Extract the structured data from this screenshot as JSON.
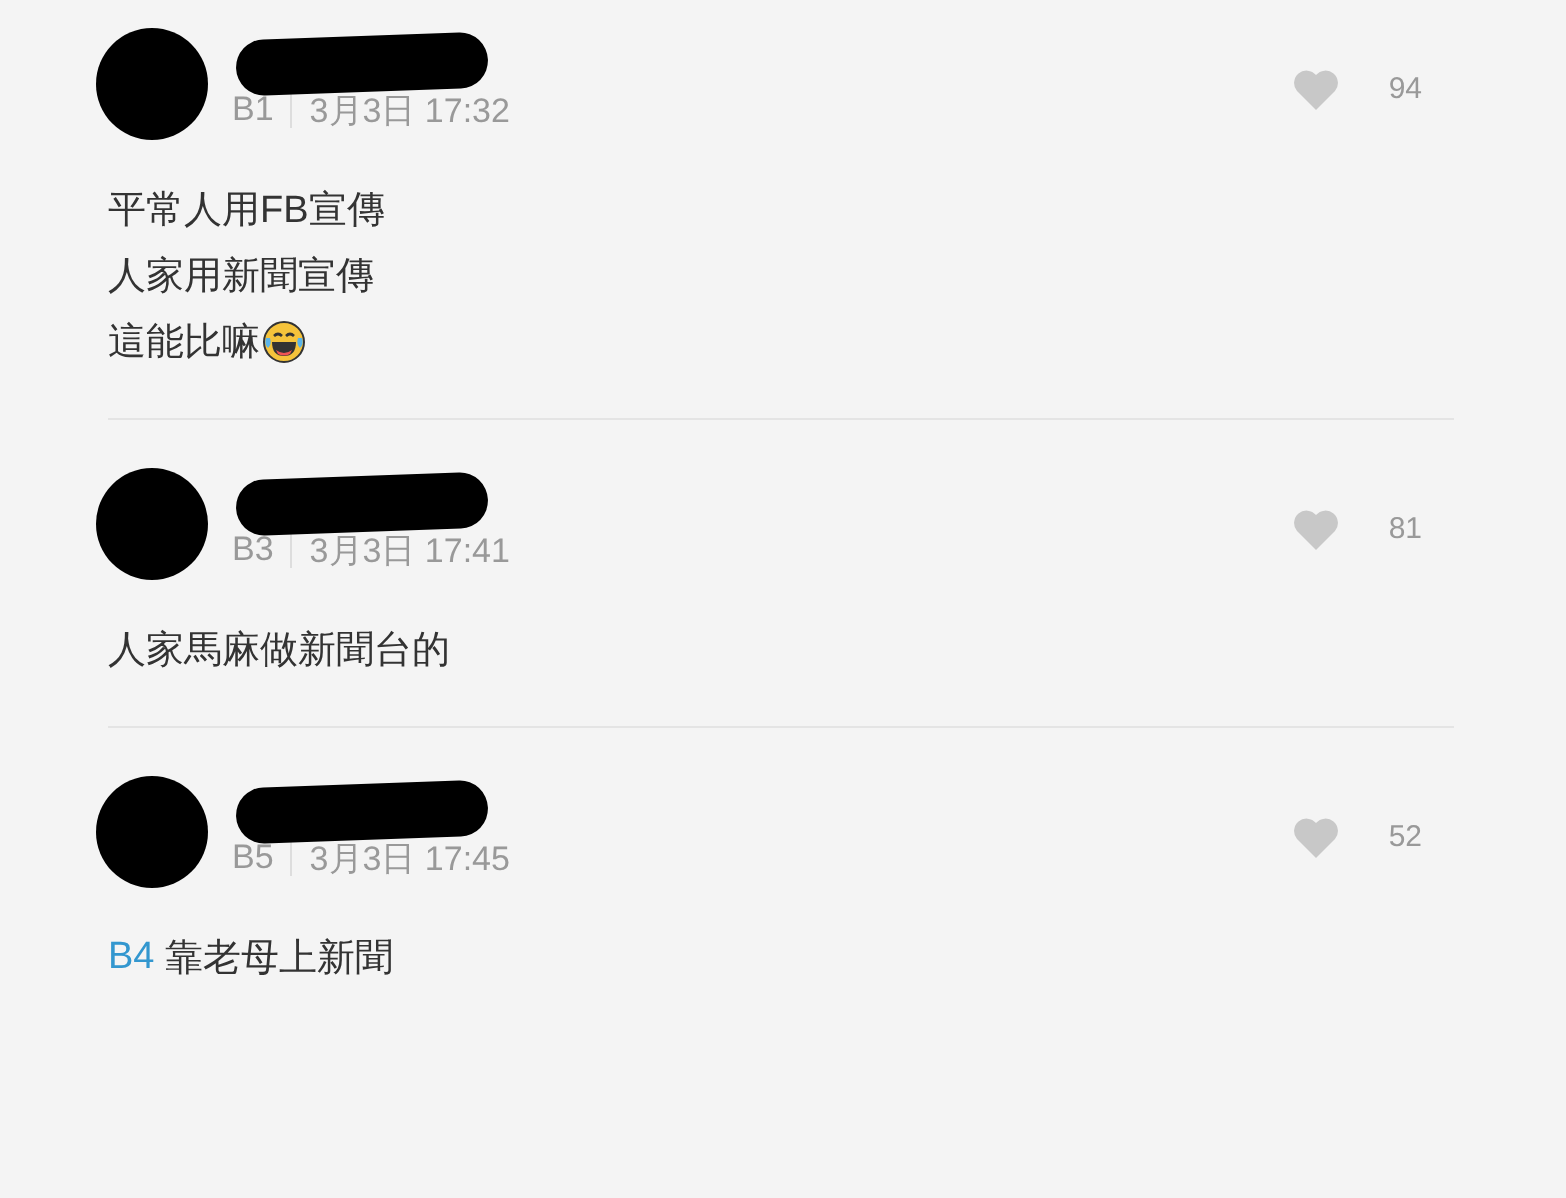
{
  "comments": [
    {
      "floor": "B1",
      "time": "3月3日 17:32",
      "likes": "94",
      "body": [
        [
          {
            "kind": "text",
            "text": "平常人用FB宣傳"
          }
        ],
        [
          {
            "kind": "text",
            "text": "人家用新聞宣傳"
          }
        ],
        [
          {
            "kind": "text",
            "text": "這能比嘛"
          },
          {
            "kind": "emoji"
          }
        ]
      ]
    },
    {
      "floor": "B3",
      "time": "3月3日 17:41",
      "likes": "81",
      "body": [
        [
          {
            "kind": "text",
            "text": "人家馬麻做新聞台的"
          }
        ]
      ]
    },
    {
      "floor": "B5",
      "time": "3月3日 17:45",
      "likes": "52",
      "body": [
        [
          {
            "kind": "mention",
            "text": "B4"
          },
          {
            "kind": "text",
            "text": " 靠老母上新聞"
          }
        ]
      ]
    }
  ]
}
